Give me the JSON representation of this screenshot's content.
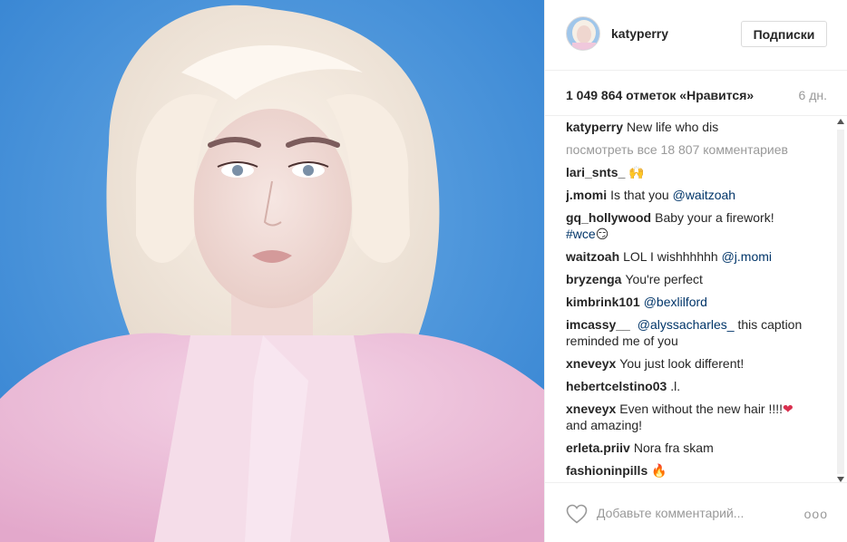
{
  "post": {
    "username": "katyperry",
    "follow_label": "Подписки",
    "likes": "1 049 864 отметок «Нравится»",
    "time": "6 дн.",
    "caption_user": "katyperry",
    "caption_text": "New life who dis",
    "view_all": "посмотреть все 18 807 комментариев"
  },
  "comments": [
    {
      "user": "lari_snts_",
      "text": "",
      "emoji": "🙌",
      "emoji_color": "#3c9c3c"
    },
    {
      "user": "j.momi",
      "text": "Is that you",
      "mention": "@waitzoah"
    },
    {
      "user": "gq_hollywood",
      "text": "Baby your a firework!",
      "hashtag": "#wce",
      "emoji": "😏"
    },
    {
      "user": "waitzoah",
      "text": "LOL I wishhhhhh",
      "mention": "@j.momi"
    },
    {
      "user": "bryzenga",
      "text": "You're perfect"
    },
    {
      "user": "kimbrink101",
      "text": "",
      "mention": "@bexlilford"
    },
    {
      "user": "imcassy__",
      "text": "",
      "mention": "@alyssacharles_",
      "text_after": "this caption reminded me of you"
    },
    {
      "user": "xneveyx",
      "text": "You just look different!"
    },
    {
      "user": "hebertcelstino03",
      "text": ".l."
    },
    {
      "user": "xneveyx",
      "text": "Even without the new hair !!!!",
      "emoji": "❤",
      "text_after": "and amazing!"
    },
    {
      "user": "erleta.priiv",
      "text": "Nora fra skam"
    },
    {
      "user": "fashioninpills",
      "text": "",
      "emoji": "🔥"
    }
  ],
  "add_comment": {
    "placeholder": "Добавьте комментарий...",
    "more": "ooo"
  },
  "colors": {
    "mention": "#003569",
    "muted": "#999999",
    "photo_bg": "#3f8fd6"
  }
}
